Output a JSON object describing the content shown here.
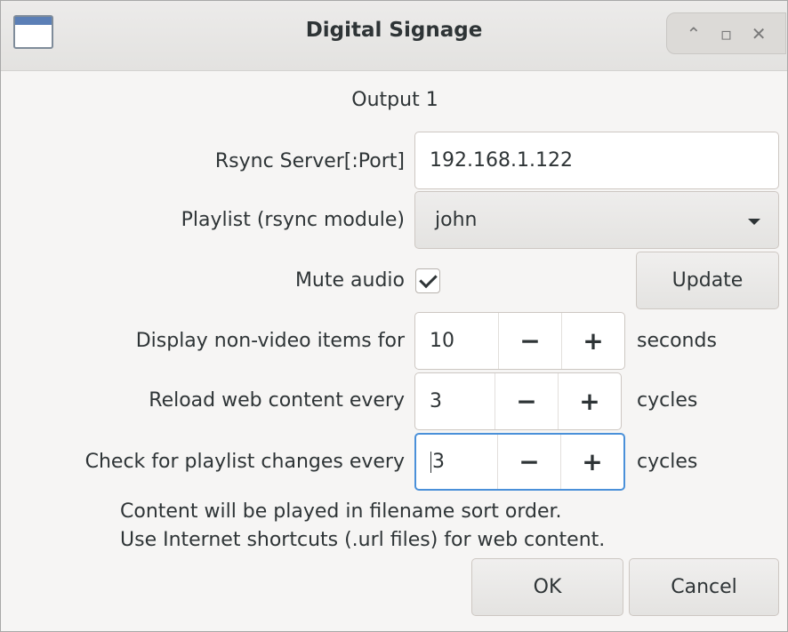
{
  "window": {
    "title": "Digital Signage",
    "controls": {
      "minimize": "⌃",
      "maximize": "▫",
      "close": "✕"
    }
  },
  "header": {
    "output_label": "Output 1"
  },
  "form": {
    "rsync_label": "Rsync Server[:Port]",
    "rsync_value": "192.168.1.122",
    "playlist_label": "Playlist (rsync module)",
    "playlist_value": "john",
    "mute_label": "Mute audio",
    "mute_checked": true,
    "update_button": "Update",
    "display_label": "Display non-video items for",
    "display_value": "10",
    "display_unit": "seconds",
    "reload_label": "Reload web content every",
    "reload_value": "3",
    "reload_unit": "cycles",
    "check_label": "Check for playlist changes every",
    "check_value": "3",
    "check_unit": "cycles",
    "minus": "−",
    "plus": "+"
  },
  "notes": {
    "line1": "Content will be played in filename sort order.",
    "line2": "Use Internet shortcuts (.url files) for web content."
  },
  "footer": {
    "ok": "OK",
    "cancel": "Cancel"
  },
  "colors": {
    "focus": "#4a90d9",
    "background": "#f6f5f4"
  }
}
